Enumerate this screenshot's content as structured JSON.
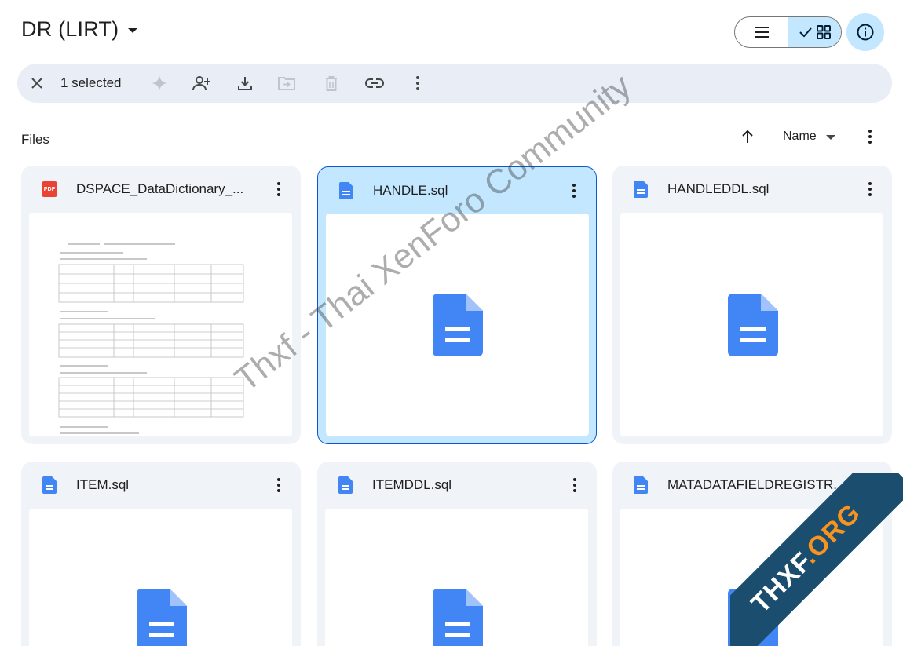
{
  "header": {
    "title": "DR (LIRT)"
  },
  "selection_bar": {
    "selected_text": "1 selected"
  },
  "files": {
    "section_label": "Files",
    "sort_label": "Name"
  },
  "cards": [
    {
      "name": "DSPACE_DataDictionary_...",
      "icon": "pdf-icon",
      "selected": false
    },
    {
      "name": "HANDLE.sql",
      "icon": "doc-icon",
      "selected": true
    },
    {
      "name": "HANDLEDDL.sql",
      "icon": "doc-icon",
      "selected": false
    },
    {
      "name": "ITEM.sql",
      "icon": "doc-icon",
      "selected": false
    },
    {
      "name": "ITEMDDL.sql",
      "icon": "doc-icon",
      "selected": false
    },
    {
      "name": "MATADATAFIELDREGISTR...",
      "icon": "doc-icon",
      "selected": false
    }
  ],
  "pdf_badge": "PDF",
  "watermark": {
    "text": "Thxf - Thai XenForo Community",
    "corner_a": "THXF",
    "corner_dot": ".",
    "corner_b": "ORG"
  },
  "colors": {
    "accent": "#0b57d0",
    "selected_bg": "#c2e7ff",
    "card_bg": "#f0f4f9",
    "doc_blue": "#4285f4",
    "pdf_red": "#ea4335"
  }
}
